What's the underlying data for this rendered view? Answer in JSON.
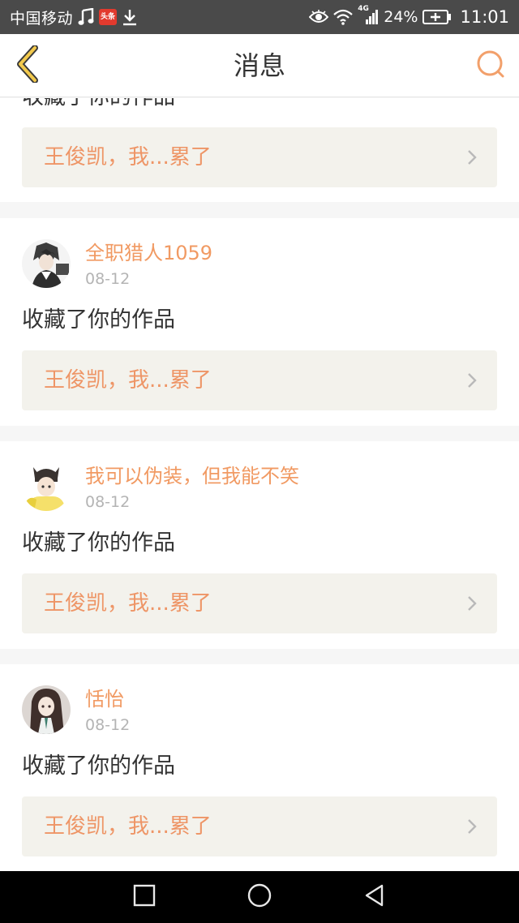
{
  "status_bar": {
    "carrier": "中国移动",
    "icons": [
      "music-note-icon",
      "news-app-icon",
      "download-icon",
      "eye-icon",
      "wifi-icon",
      "signal-4g-icon",
      "battery-charging-icon"
    ],
    "news_badge_label": "头条",
    "network_label": "4G",
    "battery_percent": "24%",
    "time": "11:01"
  },
  "header": {
    "title": "消息",
    "back_icon": "chevron-left-icon",
    "search_icon": "search-icon"
  },
  "colors": {
    "accent": "#f19a63",
    "work_title": "#ee9566",
    "back_arrow": "#f2c94c",
    "card_link_bg": "#f3f2ec",
    "status_bar_bg": "#4a4a4a"
  },
  "partial_message": {
    "action": "收藏了你的作品",
    "work_title": "王俊凯，我...累了"
  },
  "messages": [
    {
      "username": "全职猎人1059",
      "date": "08-12",
      "action": "收藏了你的作品",
      "work_title": "王俊凯，我...累了"
    },
    {
      "username": "我可以伪装，但我能不笑",
      "date": "08-12",
      "action": "收藏了你的作品",
      "work_title": "王俊凯，我...累了"
    },
    {
      "username": "恬怡",
      "date": "08-12",
      "action": "收藏了你的作品",
      "work_title": "王俊凯，我...累了"
    }
  ],
  "system_nav": {
    "icons": [
      "square-recent-apps-icon",
      "circle-home-icon",
      "triangle-back-icon"
    ]
  }
}
